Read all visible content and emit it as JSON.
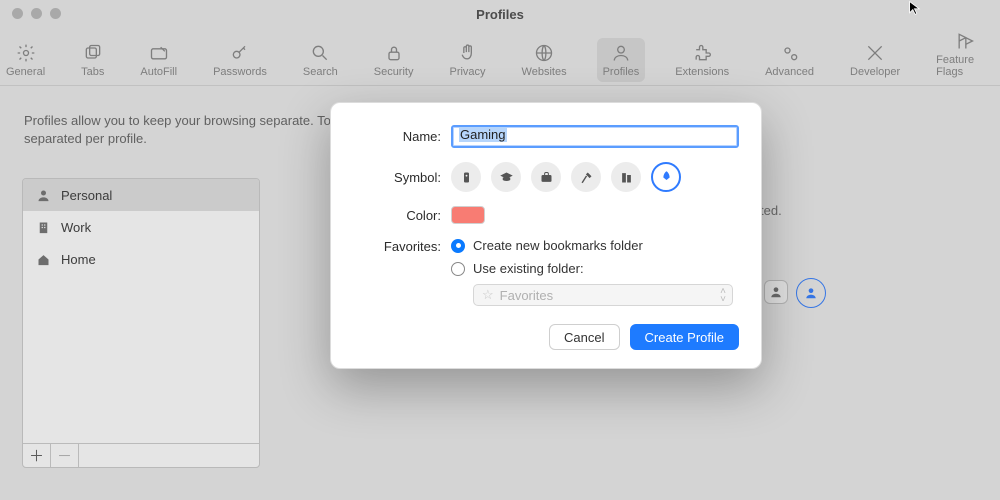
{
  "window": {
    "title": "Profiles"
  },
  "toolbar": [
    "General",
    "Tabs",
    "AutoFill",
    "Passwords",
    "Search",
    "Security",
    "Privacy",
    "Websites",
    "Profiles",
    "Extensions",
    "Advanced",
    "Developer",
    "Feature Flags"
  ],
  "page": {
    "desc_line1": "Profiles allow you to keep your browsing separate. Topics, like bookmarks, favorites, history, cookies, and website data",
    "desc_line2": "separated per profile.",
    "bg_hint": "ted."
  },
  "profiles": [
    {
      "name": "Personal",
      "icon": "person"
    },
    {
      "name": "Work",
      "icon": "building"
    },
    {
      "name": "Home",
      "icon": "house"
    }
  ],
  "modal": {
    "name_label": "Name:",
    "name_value": "Gaming",
    "symbol_label": "Symbol:",
    "symbols": [
      "badge",
      "graduation",
      "briefcase",
      "hammer",
      "building",
      "rocket"
    ],
    "symbol_selected": "rocket",
    "color_label": "Color:",
    "color_value": "#f87c73",
    "favorites_label": "Favorites:",
    "fav_opt_create": "Create new bookmarks folder",
    "fav_opt_existing": "Use existing folder:",
    "fav_selected": "create",
    "folder_popup_value": "Favorites",
    "cancel": "Cancel",
    "create": "Create Profile"
  },
  "colors": {
    "accent": "#1e7bff"
  }
}
